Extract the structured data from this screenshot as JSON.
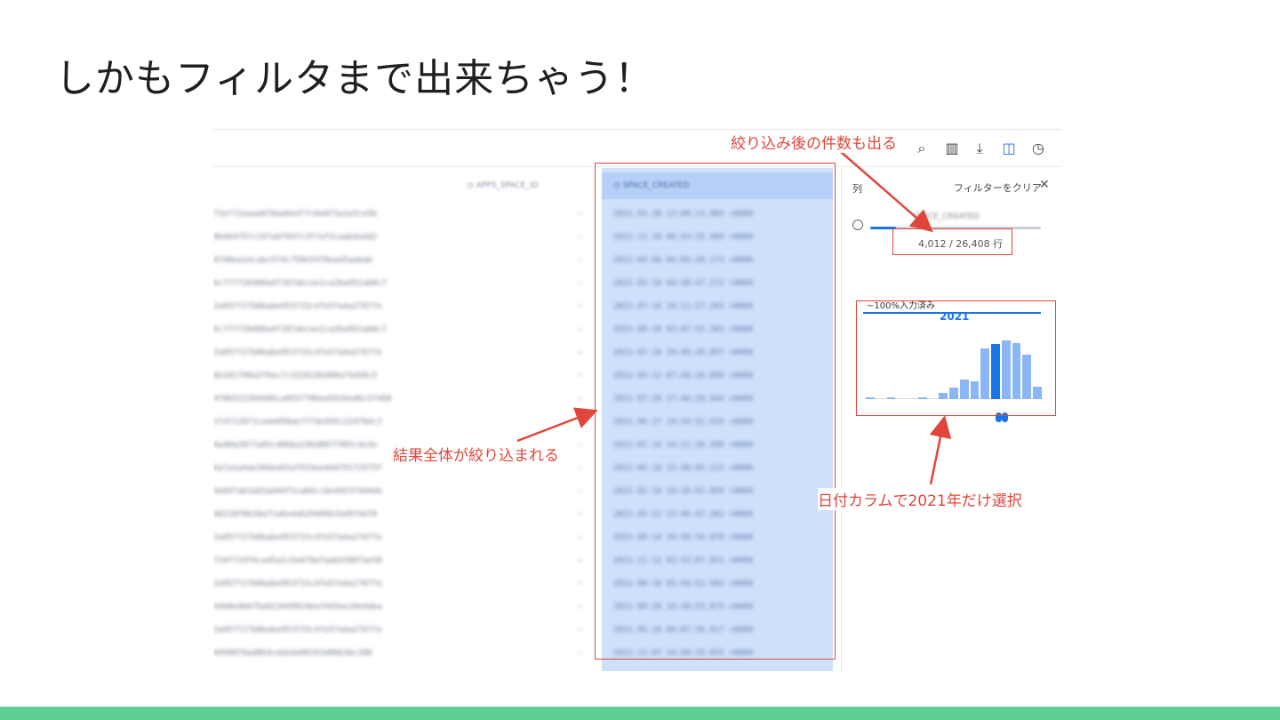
{
  "slide": {
    "title": "しかもフィルタまで出来ちゃう！",
    "accent_color": "#5ecf93"
  },
  "toolbar": {
    "icons": [
      "search-icon",
      "columns-icon",
      "download-icon",
      "side-panel-icon",
      "history-icon"
    ]
  },
  "grid": {
    "columns": [
      "APPS_SPACE_ID",
      "SPACE_CREATED"
    ],
    "left_col_rows": [
      "f3ef72aaaa6f8aa6e4f7c6e6f3a1e5ce5b",
      "8b4b4f57c247a6f947c3f7af3caab4a4d2",
      "0fd0ea14cabc974c758e54f8ea45aabab",
      "6c7f7f20480a4f187abcee1ca2ba951ab0c7",
      "2a957f27b0babe953f33c4fe57a4a2767fe",
      "6c7f7f20480a4f187abcee1ca2ba951ab0c7",
      "2a957f27b0babe953f33c4fe57a4a2767fe",
      "8e181798a2f9ac7c322819b488a75d58c5",
      "4f8b522384486ca055778bea5916ed6c5f408",
      "1f4f12871ca4e058ae7f74e595c224f6dc3",
      "4a40a28f7a85c40bba196d8877985c4e3e",
      "4a7a1a4ae384ee62af933ee4dd79172575f",
      "4e05fab3ab5ad44f5ca84ccbe44537444eb",
      "40218f8b18a71a6e4a629409b1bd9f4d78",
      "2a957f27b0babe953f33c4fe57a4a2767fe",
      "f34f719f6ca45a1c5e6f8a7aab43887ae50",
      "2a957f27b0babe953f33c4fe57a4a2767fe",
      "44b0e4b675a823449924baf445ee10e9aba",
      "2a957f27b0babe953f33c4fe57a4a2767fe",
      "44900f0ad8b4cebb4d40343d06b3bc30b"
    ],
    "created_rows": [
      "2021-03-30 13:00:13.004 +0000",
      "2021-11-10 06:43:35.489 +0000",
      "2021-04-06 04:05:20.173 +0000",
      "2021-05-10 04:48:47.272 +0000",
      "2021-07-16 18:11:27.283 +0000",
      "2021-09-20 03:07:52.303 +0000",
      "2021-07-16 19:40:28.897 +0000",
      "2021-03-12 07:48:16.098 +0000",
      "2021-07-28 17:46:28.544 +0000",
      "2021-06-27 14:54:52.634 +0000",
      "2021-07-14 14:21:38.590 +0000",
      "2021-05-18 15:48:05.215 +0000",
      "2021-02-19 19:28:01.894 +0000",
      "2021-05-22 23:46:47.202 +0000",
      "2021-09-14 16:58:34.078 +0000",
      "2021-11-12 02:53:07.851 +0000",
      "2021-08-10 05:54:52.583 +0000",
      "2021-09-28 10:30:53.075 +0000",
      "2021-05-18 04:07:36.817 +0000",
      "2021-12-07 14:08:35.055 +0000"
    ]
  },
  "side_panel": {
    "section_label": "列",
    "clear_label": "フィルターをクリア",
    "close_icon": "close-icon",
    "field_name": "SPACE_CREATED",
    "count_label": "4,012 / 26,408 行",
    "completeness_label": "~100%入力済み",
    "histogram_year": "2021",
    "histogram_levels": [
      2,
      0,
      2,
      0,
      0,
      2,
      0,
      10,
      18,
      30,
      28,
      80,
      86,
      92,
      88,
      70,
      20
    ],
    "histogram_selected_index": 12,
    "filter_fraction": 0.15
  },
  "annotations": {
    "count_note": "絞り込み後の件数も出る",
    "result_note": "結果全体が絞り込まれる",
    "date_note": "日付カラムで2021年だけ選択",
    "color": "#e0463b"
  }
}
